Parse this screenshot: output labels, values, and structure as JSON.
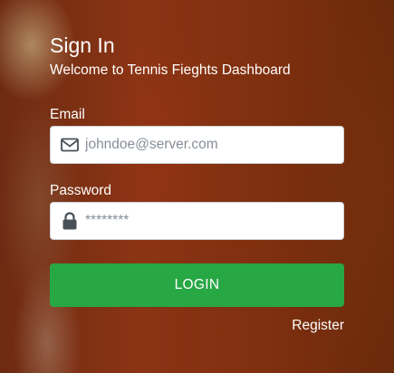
{
  "header": {
    "title": "Sign In",
    "subtitle": "Welcome to Tennis Fieghts Dashboard"
  },
  "email": {
    "label": "Email",
    "placeholder": "johndoe@server.com",
    "icon": "envelope-icon"
  },
  "password": {
    "label": "Password",
    "placeholder": "********",
    "icon": "lock-icon"
  },
  "actions": {
    "login_label": "LOGIN",
    "register_label": "Register"
  },
  "colors": {
    "login_button": "#28a745",
    "background": "#7a2c0e",
    "text": "#ffffff"
  }
}
